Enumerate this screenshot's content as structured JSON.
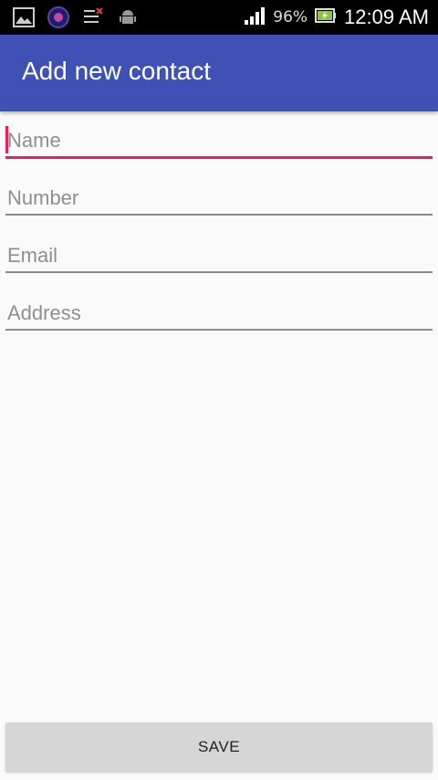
{
  "status_bar": {
    "icons": [
      "gallery-icon",
      "app-icon",
      "notification-list-icon",
      "android-icon"
    ],
    "battery_percent": "96%",
    "time": "12:09 AM"
  },
  "app_bar": {
    "title": "Add new contact"
  },
  "form": {
    "fields": [
      {
        "placeholder": "Name",
        "value": ""
      },
      {
        "placeholder": "Number",
        "value": ""
      },
      {
        "placeholder": "Email",
        "value": ""
      },
      {
        "placeholder": "Address",
        "value": ""
      }
    ]
  },
  "actions": {
    "save_label": "SAVE"
  },
  "colors": {
    "primary": "#3f51b5",
    "accent": "#e91e63",
    "background": "#fafafa",
    "button": "#d6d6d6"
  }
}
